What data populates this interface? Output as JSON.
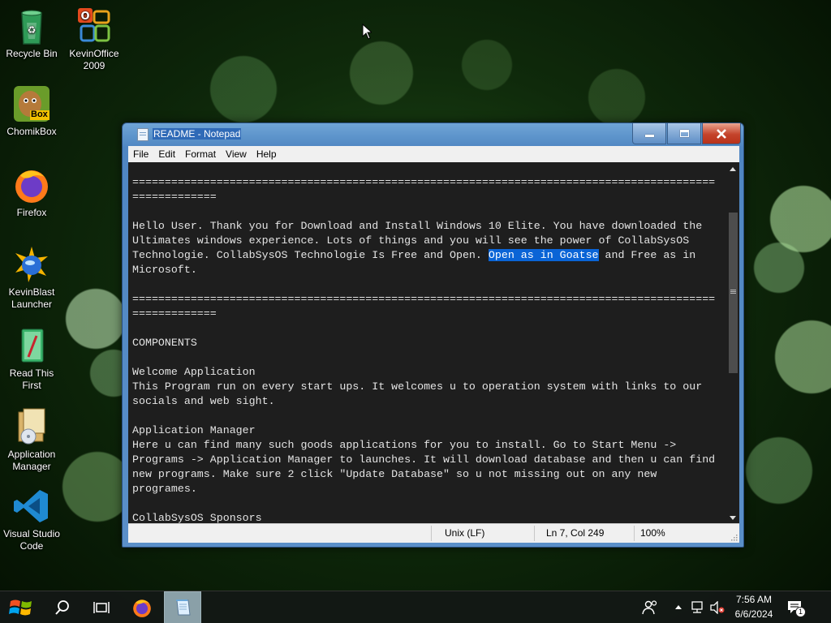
{
  "desktop": {
    "icons": [
      {
        "label": "Recycle Bin",
        "icon": "recycle-bin-icon"
      },
      {
        "label": "KevinOffice 2009",
        "icon": "office-icon"
      },
      {
        "label": "ChomikBox",
        "icon": "chomikbox-icon",
        "badge": "Box"
      },
      {
        "label": "Firefox",
        "icon": "firefox-icon"
      },
      {
        "label": "KevinBlast Launcher",
        "icon": "launcher-icon"
      },
      {
        "label": "Read This First",
        "icon": "book-icon"
      },
      {
        "label": "Application Manager",
        "icon": "installer-icon"
      },
      {
        "label": "Visual Studio Code",
        "icon": "vscode-icon"
      }
    ]
  },
  "notepad": {
    "title": "README - Notepad",
    "menu": [
      "File",
      "Edit",
      "Format",
      "View",
      "Help"
    ],
    "lines": [
      "==========================================================================================",
      "=============",
      "",
      "Hello User. Thank you for Download and Install Windows 10 Elite. You have downloaded the",
      "Ultimates windows experience. Lots of things and you will see the power of CollabSysOS",
      "",
      "Microsoft.",
      "",
      "==========================================================================================",
      "=============",
      "",
      "COMPONENTS",
      "",
      "Welcome Application",
      "This Program run on every start ups. It welcomes u to operation system with links to our",
      "socials and web sight.",
      "",
      "Application Manager",
      "Here u can find many such goods applications for you to install. Go to Start Menu ->",
      "Programs -> Application Manager to launches. It will download database and then u can find",
      "new programs. Make sure 2 click \"Update Database\" so u not missing out on any new",
      "programes.",
      "",
      "CollabSysOS Sponsors"
    ],
    "selection_line": {
      "before": "Technologie. CollabSysOS Technologie Is Free and Open. ",
      "selected": "Open as in Goatse",
      "after": " and Free as in"
    },
    "status": {
      "line_ending": "Unix (LF)",
      "position": "Ln 7, Col 249",
      "zoom": "100%"
    }
  },
  "taskbar": {
    "clock_time": "7:56 AM",
    "clock_date": "6/6/2024",
    "notification_count": "1"
  },
  "colors": {
    "editor_bg": "#1e1e1e",
    "selection": "#0a64d6",
    "window_frame": "#5a8fc8",
    "close_button": "#c4432b"
  }
}
